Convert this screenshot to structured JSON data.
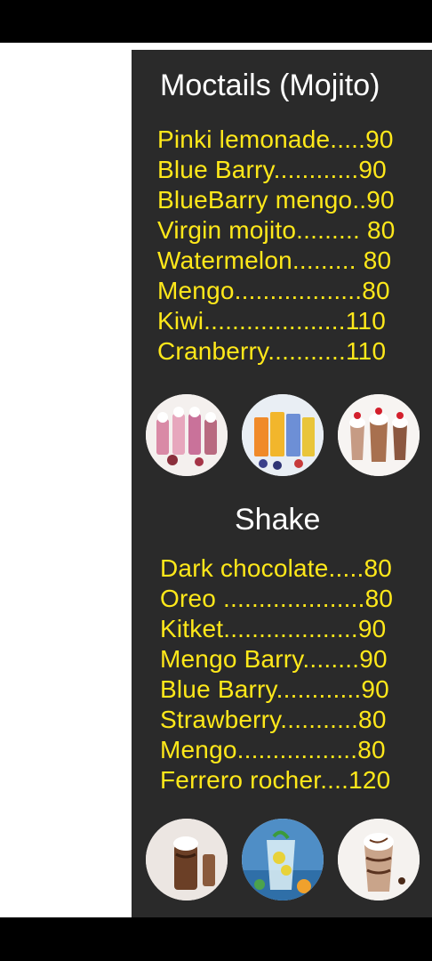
{
  "colors": {
    "panel_background": "#2a2a2a",
    "item_text": "#ffe81a",
    "heading_text": "#ffffff"
  },
  "sections": [
    {
      "title": "Moctails (Mojito)",
      "items": [
        "Pinki lemonade.....90",
        "Blue Barry............90",
        "BlueBarry mengo..90",
        "Virgin mojito......... 80",
        "Watermelon.........  80",
        "Mengo..................80",
        "Kiwi....................110",
        "Cranberry...........110"
      ],
      "photos": [
        "milkshake-glasses-photo",
        "colorful-mojito-glasses-photo",
        "cherry-shake-cups-photo"
      ]
    },
    {
      "title": "Shake",
      "items": [
        "Dark chocolate.....80",
        "Oreo ....................80",
        "Kitket...................90",
        "Mengo Barry........90",
        "Blue Barry............90",
        "Strawberry...........80",
        "Mengo.................80",
        "Ferrero rocher....120"
      ],
      "photos": [
        "chocolate-shake-photo",
        "citrus-mojito-photo",
        "mocha-frappe-photo"
      ]
    }
  ]
}
